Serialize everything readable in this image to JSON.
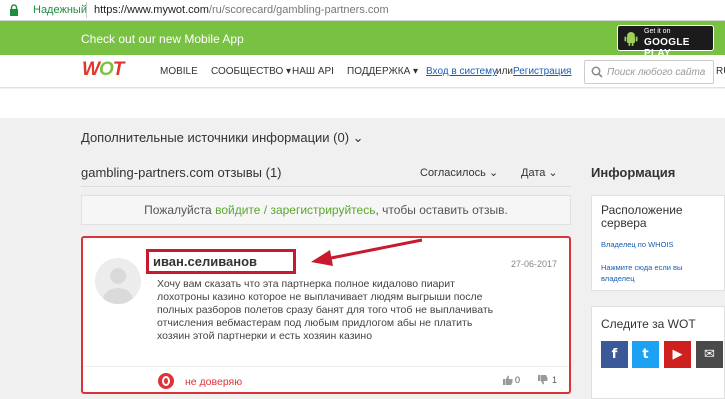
{
  "browser": {
    "secure_label": "Надежный",
    "url_host": "https://www.mywot.com",
    "url_path": "/ru/scorecard/gambling-partners.com"
  },
  "banner": {
    "text": "Check out our new Mobile App",
    "store_small": "Get it on",
    "store_big": "GOOGLE PLAY"
  },
  "nav": {
    "logo_w": "W",
    "logo_o": "O",
    "logo_t": "T",
    "mobile": "MOBILE",
    "community": "СООБЩЕСТВО ▾",
    "api": "НАШ API",
    "support": "ПОДДЕРЖКА ▾",
    "login": "Вход в систему",
    "or": "или",
    "register": "Регистрация",
    "search_placeholder": "Поиск любого сайта",
    "lang": "RU"
  },
  "content": {
    "extra_sources": "Дополнительные источники информации (0) ⌄",
    "reviews_title": "gambling-partners.com отзывы (1)",
    "sort_agree": "Согласилось ⌄",
    "sort_date": "Дата ⌄",
    "info_title": "Информация",
    "login_prompt_pre": "Пожалуйста ",
    "login_prompt_link": "войдите / зарегистрируйтесь",
    "login_prompt_post": ", чтобы оставить отзыв."
  },
  "review": {
    "username": "иван.селиванов",
    "date": "27-06-2017",
    "text": "Хочу вам сказать что эта партнерка полное кидалово пиарит лохотроны казино которое не выплачивает людям выгрыши после полных разборов полетов сразу банят для того чтоб не выплачивать отчисления вебмастерам под любым придлогом абы не платить хозяин этой партнерки и есть хозяин казино",
    "verdict": "не доверяю",
    "likes": "0",
    "dislikes": "1"
  },
  "sidebar": {
    "server_title": "Расположение сервера",
    "whois": "Владелец по WHOIS",
    "owner_link": "Нажмите сюда если вы владелец",
    "follow_title": "Следите за WOT",
    "social": [
      {
        "name": "facebook",
        "glyph": "f",
        "color": "#3b5998"
      },
      {
        "name": "twitter",
        "glyph": "t",
        "color": "#1da1f2"
      },
      {
        "name": "youtube",
        "glyph": "▶",
        "color": "#cd201f"
      },
      {
        "name": "email",
        "glyph": "✉",
        "color": "#4a4a4a"
      }
    ]
  },
  "colors": {
    "banner": "#78c143",
    "accent_red": "#d9343a",
    "link": "#1a5db4"
  }
}
